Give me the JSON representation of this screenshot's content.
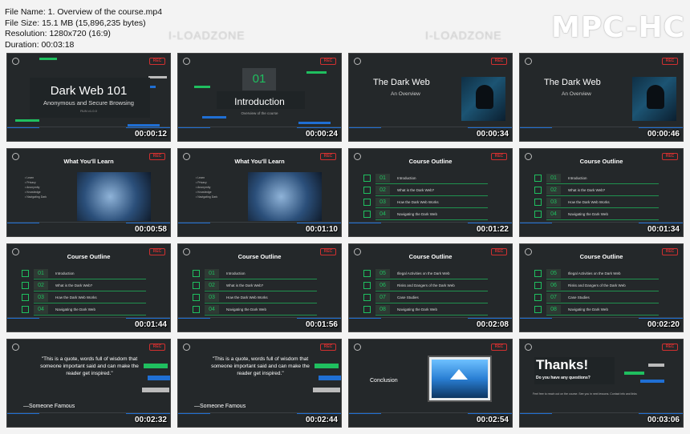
{
  "header": {
    "file_name": "File Name: 1. Overview of the course.mp4",
    "file_size": "File Size: 15.1 MB (15,896,235 bytes)",
    "resolution": "Resolution: 1280x720 (16:9)",
    "duration": "Duration: 00:03:18"
  },
  "brand": "MPC-HC",
  "watermark": "I-LOADZONE",
  "rec_label": "REC",
  "thumbnails": [
    {
      "type": "title",
      "time": "00:00:12",
      "title": "Dark Web 101",
      "subtitle": "Anonymous and Secure Browsing",
      "small": "RUN v1.0.0"
    },
    {
      "type": "intro",
      "time": "00:00:24",
      "num": "01",
      "title": "Introduction",
      "subtitle": "Overview of the course"
    },
    {
      "type": "darkweb",
      "time": "00:00:34",
      "title": "The Dark Web",
      "subtitle": "An Overview"
    },
    {
      "type": "darkweb",
      "time": "00:00:46",
      "title": "The Dark Web",
      "subtitle": "An Overview"
    },
    {
      "type": "learn",
      "time": "00:00:58",
      "title": "What You'll Learn",
      "items": [
        "Learn",
        "Privacy",
        "Anonymity",
        "Knowledge",
        "Navigating Dark"
      ]
    },
    {
      "type": "learn",
      "time": "00:01:10",
      "title": "What You'll Learn",
      "items": [
        "Learn",
        "Privacy",
        "Anonymity",
        "Knowledge",
        "Navigating Dark"
      ]
    },
    {
      "type": "outline",
      "time": "00:01:22",
      "title": "Course Outline",
      "rows": [
        {
          "num": "01",
          "text": "Introduction"
        },
        {
          "num": "02",
          "text": "What is the Dark Web?"
        },
        {
          "num": "03",
          "text": "How the Dark Web Works"
        },
        {
          "num": "04",
          "text": "Navigating the Dark Web"
        }
      ]
    },
    {
      "type": "outline",
      "time": "00:01:34",
      "title": "Course Outline",
      "rows": [
        {
          "num": "01",
          "text": "Introduction"
        },
        {
          "num": "02",
          "text": "What is the Dark Web?"
        },
        {
          "num": "03",
          "text": "How the Dark Web Works"
        },
        {
          "num": "04",
          "text": "Navigating the Dark Web"
        }
      ]
    },
    {
      "type": "outline",
      "time": "00:01:44",
      "title": "Course Outline",
      "rows": [
        {
          "num": "01",
          "text": "Introduction"
        },
        {
          "num": "02",
          "text": "What is the Dark Web?"
        },
        {
          "num": "03",
          "text": "How the Dark Web Works"
        },
        {
          "num": "04",
          "text": "Navigating the Dark Web"
        }
      ]
    },
    {
      "type": "outline",
      "time": "00:01:56",
      "title": "Course Outline",
      "rows": [
        {
          "num": "01",
          "text": "Introduction"
        },
        {
          "num": "02",
          "text": "What is the Dark Web?"
        },
        {
          "num": "03",
          "text": "How the Dark Web Works"
        },
        {
          "num": "04",
          "text": "Navigating the Dark Web"
        }
      ]
    },
    {
      "type": "outline",
      "time": "00:02:08",
      "title": "Course Outline",
      "rows": [
        {
          "num": "05",
          "text": "Illegal Activities on the Dark Web"
        },
        {
          "num": "06",
          "text": "Risks and Dangers of the Dark Web"
        },
        {
          "num": "07",
          "text": "Case Studies"
        },
        {
          "num": "08",
          "text": "Navigating the Dark Web"
        }
      ]
    },
    {
      "type": "outline",
      "time": "00:02:20",
      "title": "Course Outline",
      "rows": [
        {
          "num": "05",
          "text": "Illegal Activities on the Dark Web"
        },
        {
          "num": "06",
          "text": "Risks and Dangers of the Dark Web"
        },
        {
          "num": "07",
          "text": "Case Studies"
        },
        {
          "num": "08",
          "text": "Navigating the Dark Web"
        }
      ]
    },
    {
      "type": "quote",
      "time": "00:02:32",
      "quote": "\"This is a quote, words full of wisdom that someone important said and can make the reader get inspired.\"",
      "author": "—Someone Famous"
    },
    {
      "type": "quote",
      "time": "00:02:44",
      "quote": "\"This is a quote, words full of wisdom that someone important said and can make the reader get inspired.\"",
      "author": "—Someone Famous"
    },
    {
      "type": "conclusion",
      "time": "00:02:54",
      "title": "Conclusion"
    },
    {
      "type": "thanks",
      "time": "00:03:06",
      "title": "Thanks!",
      "question": "Do you have any questions?",
      "small": "Feel free to reach out on the course. See you in next lessons. Contact info and links"
    }
  ]
}
